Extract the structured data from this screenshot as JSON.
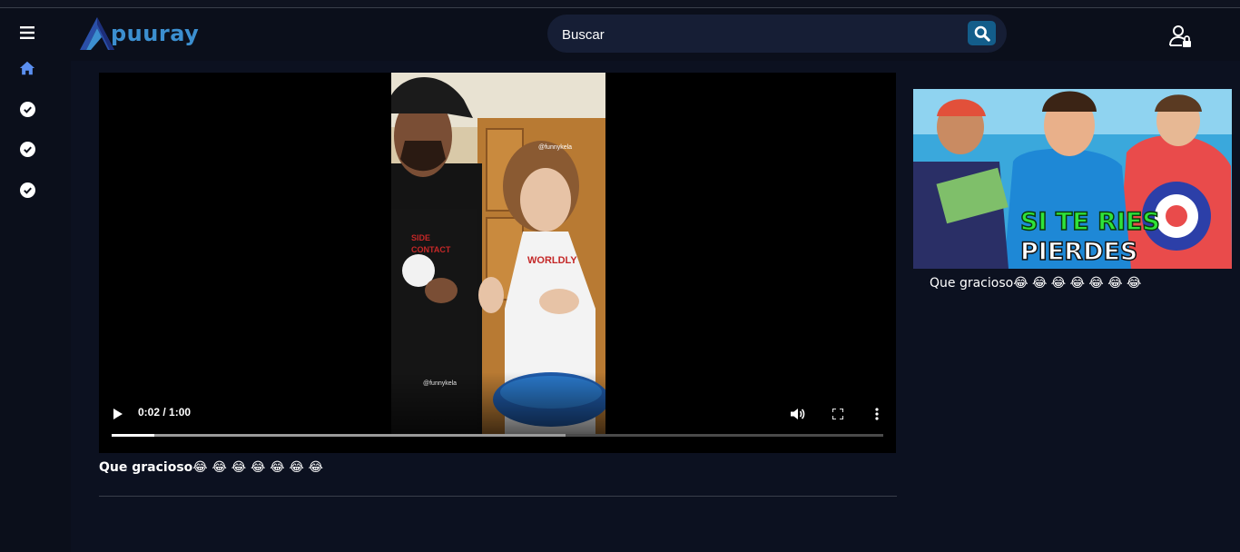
{
  "header": {
    "brand": "puuray",
    "brand_mark": "A",
    "search_placeholder": "Buscar"
  },
  "sidebar": {
    "items": [
      {
        "icon": "menu-icon"
      },
      {
        "icon": "home-icon",
        "active_color": "#5b8ff0"
      },
      {
        "icon": "check-circle-icon"
      },
      {
        "icon": "check-circle-icon"
      },
      {
        "icon": "check-circle-icon"
      }
    ]
  },
  "player": {
    "current_time": "0:02",
    "duration": "1:00",
    "time_display": "0:02 / 1:00",
    "progress_fraction": 0.055,
    "buffered_fraction": 0.588,
    "watermark": "@funnykela",
    "shirt_text": "WORLDLY"
  },
  "video": {
    "title": "Que gracioso😂 😂 😂 😂 😂 😂 😂"
  },
  "recommended": [
    {
      "title": "Que gracioso😂 😂 😂 😂 😂 😂 😂",
      "thumb_line1": "SI TE RIES",
      "thumb_line2": "PIERDES"
    }
  ],
  "colors": {
    "background": "#0b0f1b",
    "brand": "#3c8fd0",
    "search_bg": "#161e35",
    "search_button": "#135d8a"
  }
}
